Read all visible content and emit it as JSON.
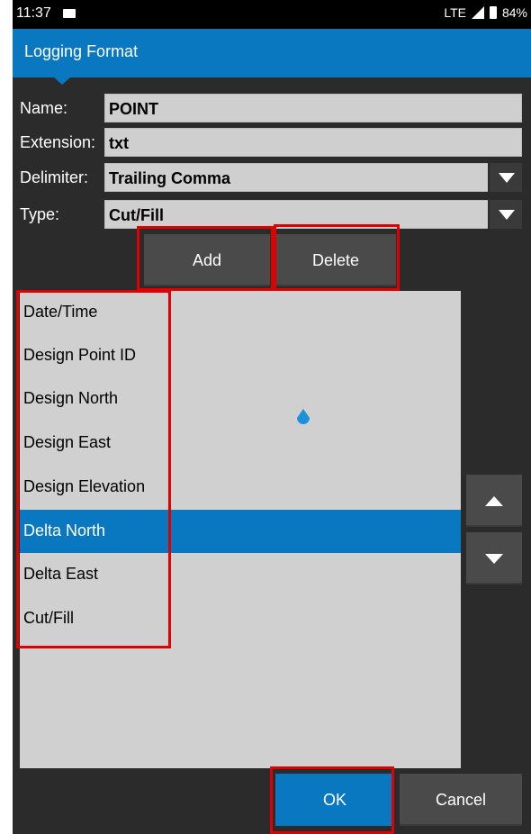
{
  "status_bar": {
    "time": "11:37",
    "network": "LTE",
    "battery": "84%"
  },
  "header": {
    "title": "Logging Format"
  },
  "form": {
    "name_label": "Name:",
    "name_value": "POINT",
    "extension_label": "Extension:",
    "extension_value": "txt",
    "delimiter_label": "Delimiter:",
    "delimiter_value": "Trailing Comma",
    "type_label": "Type:",
    "type_value": "Cut/Fill"
  },
  "buttons": {
    "add": "Add",
    "delete": "Delete",
    "ok": "OK",
    "cancel": "Cancel"
  },
  "fields_list": {
    "items": [
      "Date/Time",
      "Design Point ID",
      "Design North",
      "Design East",
      "Design Elevation",
      "Delta North",
      "Delta East",
      "Cut/Fill"
    ],
    "selected": "Delta North"
  },
  "colors": {
    "accent": "#0a78c0",
    "background": "#2b2b2b",
    "field": "#cfcfcf",
    "highlight": "#e00000"
  },
  "icons": [
    "move-up-arrow-icon",
    "move-down-arrow-icon",
    "dropdown-chevron-icon",
    "cursor-drop-icon"
  ]
}
